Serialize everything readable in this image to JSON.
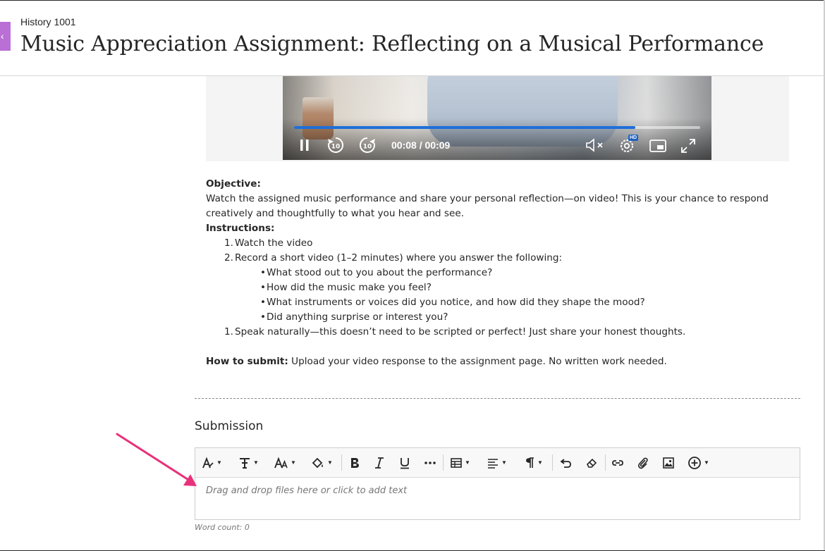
{
  "header": {
    "back_glyph": "‹",
    "course": "History 1001",
    "title": "Music Appreciation Assignment: Reflecting on a Musical Performance"
  },
  "video": {
    "time": "00:08 / 00:09",
    "progress": 0.84,
    "hd_badge": "HD",
    "rewind_label": "10",
    "forward_label": "10",
    "icons": [
      "pause-icon",
      "rewind-10-icon",
      "forward-10-icon",
      "mute-icon",
      "settings-icon",
      "picture-in-picture-icon",
      "fullscreen-icon"
    ]
  },
  "instructions": {
    "objective_heading": "Objective:",
    "objective_text": "Watch the assigned music performance and share your personal reflection—on video! This is your chance to respond creatively and thoughtfully to what you hear and see.",
    "instructions_heading": "Instructions:",
    "steps": [
      {
        "num": "1.",
        "text": "Watch the video"
      },
      {
        "num": "2.",
        "text": "Record a short video (1–2 minutes) where you answer the following:"
      }
    ],
    "questions": [
      "What stood out to you about the performance?",
      "How did the music make you feel?",
      "What instruments or voices did you notice, and how did they shape the mood?",
      "Did anything surprise or interest you?"
    ],
    "bullet_glyph": "•",
    "final_step": {
      "num": "1.",
      "text": "Speak naturally—this doesn’t need to be scripted or perfect! Just share your honest thoughts."
    },
    "submit_label": "How to submit:",
    "submit_text": " Upload your video response to the assignment page. No written work needed."
  },
  "submission": {
    "title": "Submission",
    "placeholder": "Drag and drop files here or click to add text",
    "word_count": "Word count: 0",
    "toolbar_icons": [
      "text-style-icon",
      "font-family-icon",
      "font-size-icon",
      "fill-color-icon",
      "bold-icon",
      "italic-icon",
      "underline-icon",
      "more-icon",
      "table-icon",
      "align-icon",
      "paragraph-icon",
      "undo-icon",
      "clear-format-icon",
      "link-icon",
      "attach-icon",
      "image-icon",
      "add-content-icon"
    ]
  },
  "colors": {
    "accent_tab": "#b96fd6",
    "progress": "#1e6fd9",
    "annotation_arrow": "#e8317a"
  }
}
